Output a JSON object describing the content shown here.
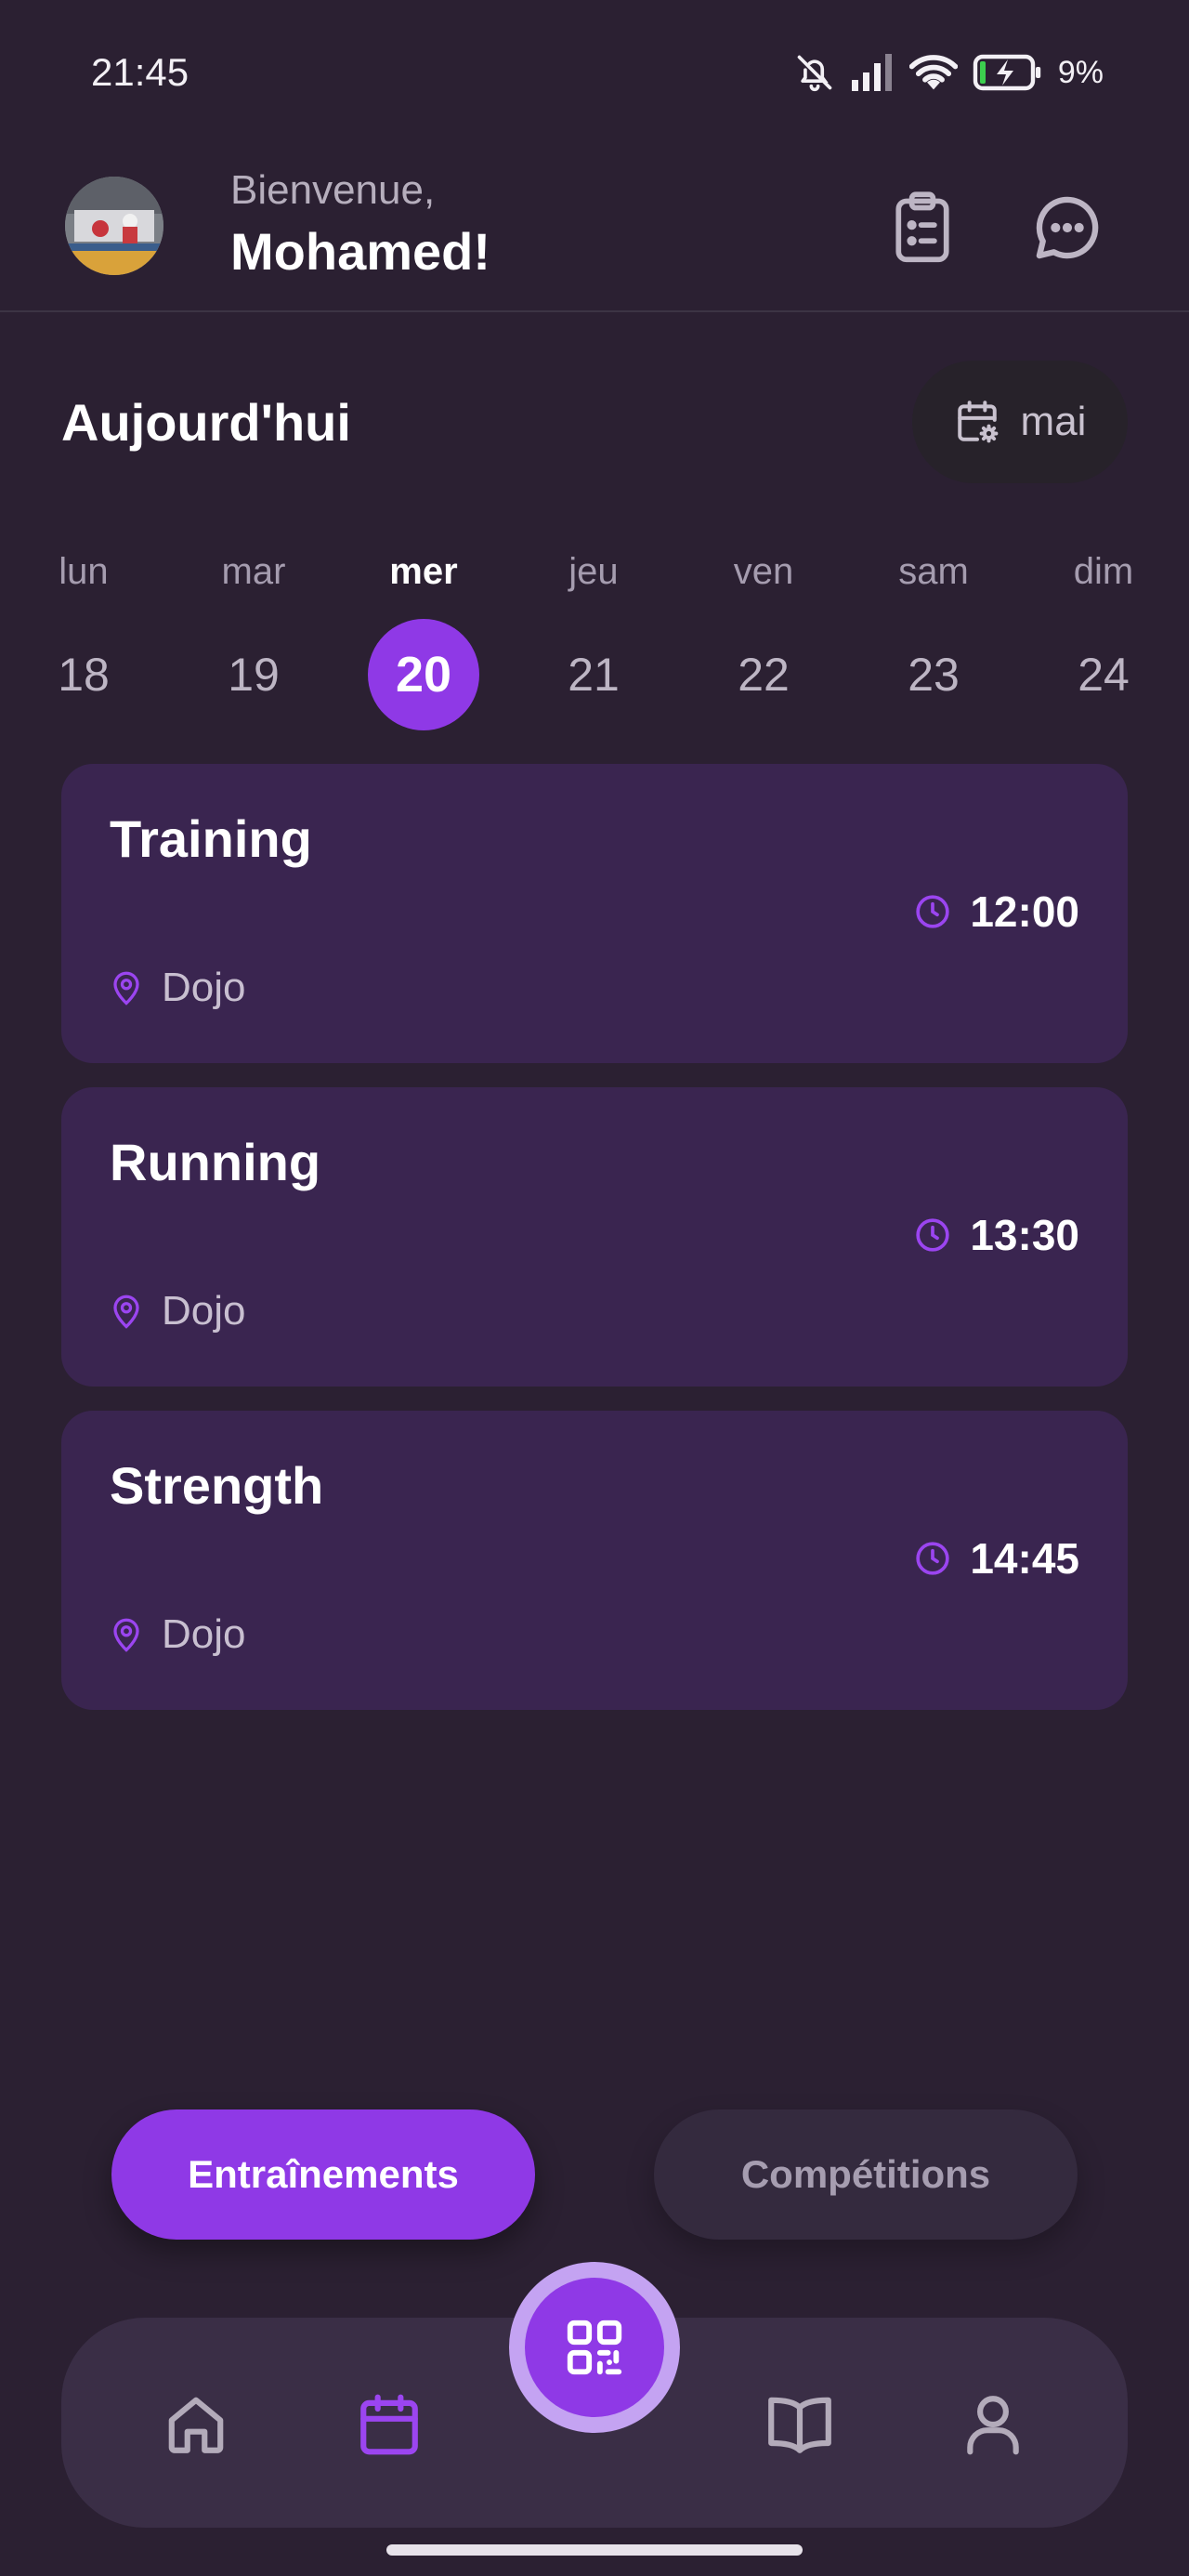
{
  "status_bar": {
    "time": "21:45",
    "battery_percent": "9%",
    "icons": [
      "bell-off-icon",
      "signal-icon",
      "wifi-icon",
      "battery-charging-icon"
    ]
  },
  "header": {
    "greeting": "Bienvenue,",
    "username": "Mohamed!",
    "actions": [
      "clipboard-icon",
      "chat-icon"
    ]
  },
  "today": {
    "title": "Aujourd'hui",
    "month_filter_label": "mai"
  },
  "week": [
    {
      "day": "lun",
      "date": "18",
      "selected": false
    },
    {
      "day": "mar",
      "date": "19",
      "selected": false
    },
    {
      "day": "mer",
      "date": "20",
      "selected": true
    },
    {
      "day": "jeu",
      "date": "21",
      "selected": false
    },
    {
      "day": "ven",
      "date": "22",
      "selected": false
    },
    {
      "day": "sam",
      "date": "23",
      "selected": false
    },
    {
      "day": "dim",
      "date": "24",
      "selected": false
    }
  ],
  "sessions": [
    {
      "title": "Training",
      "time": "12:00",
      "location": "Dojo"
    },
    {
      "title": "Running",
      "time": "13:30",
      "location": "Dojo"
    },
    {
      "title": "Strength",
      "time": "14:45",
      "location": "Dojo"
    }
  ],
  "toggle": {
    "active_label": "Entraînements",
    "inactive_label": "Compétitions"
  },
  "bottom_nav": {
    "items": [
      "home-icon",
      "calendar-icon",
      "qr-code-icon",
      "book-icon",
      "profile-icon"
    ],
    "active": "calendar-icon"
  },
  "colors": {
    "background": "#2b2032",
    "accent": "#8f39e6",
    "card": "#3a2550",
    "nav": "#3a2e46"
  }
}
